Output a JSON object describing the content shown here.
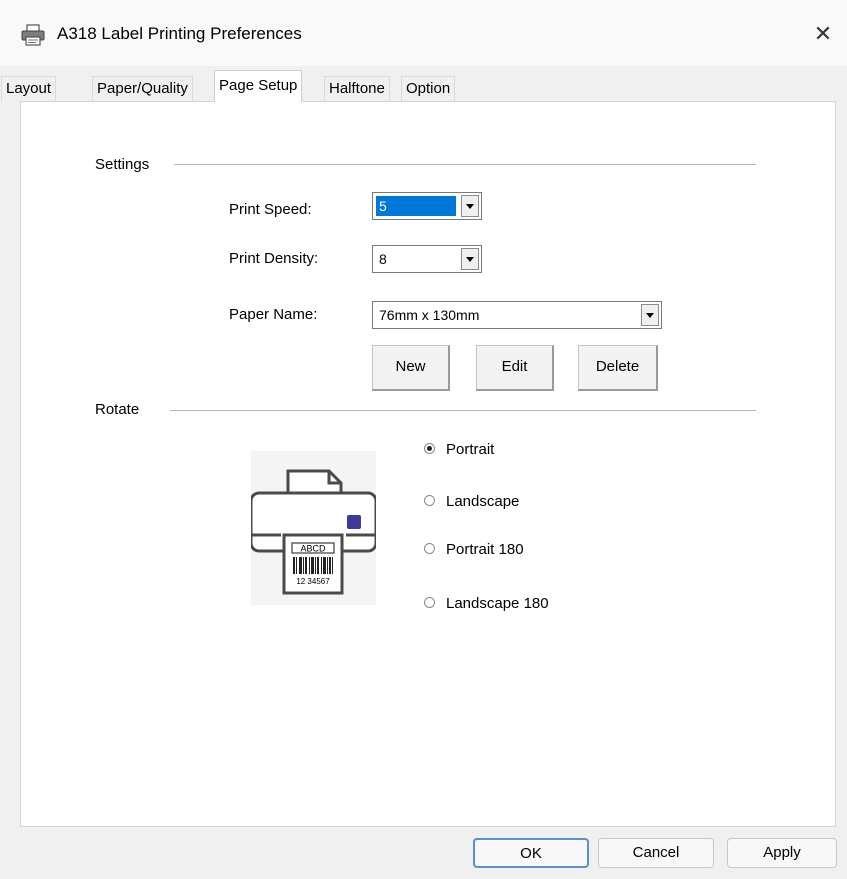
{
  "window": {
    "title": "A318 Label Printing Preferences",
    "icon": "printer-icon",
    "close_glyph": "✕"
  },
  "tabs": [
    {
      "label": "Layout",
      "active": false
    },
    {
      "label": "Paper/Quality",
      "active": false
    },
    {
      "label": "Page Setup",
      "active": true
    },
    {
      "label": "Halftone",
      "active": false
    },
    {
      "label": "Option",
      "active": false
    }
  ],
  "settings": {
    "group_label": "Settings",
    "print_speed": {
      "label": "Print Speed:",
      "value": "5"
    },
    "print_density": {
      "label": "Print Density:",
      "value": "8"
    },
    "paper_name": {
      "label": "Paper Name:",
      "value": "76mm x 130mm"
    },
    "buttons": {
      "new": "New",
      "edit": "Edit",
      "delete": "Delete"
    }
  },
  "rotate": {
    "group_label": "Rotate",
    "illustration": {
      "label_top": "ABCD",
      "label_bottom": "12 34567"
    },
    "options": [
      {
        "label": "Portrait",
        "checked": true
      },
      {
        "label": "Landscape",
        "checked": false
      },
      {
        "label": "Portrait 180",
        "checked": false
      },
      {
        "label": "Landscape 180",
        "checked": false
      }
    ]
  },
  "footer": {
    "ok": "OK",
    "cancel": "Cancel",
    "apply": "Apply"
  },
  "colors": {
    "selection": "#0078d7",
    "panel": "#ffffff",
    "chrome": "#f0f0f0",
    "indicator": "#3d3a9b"
  }
}
